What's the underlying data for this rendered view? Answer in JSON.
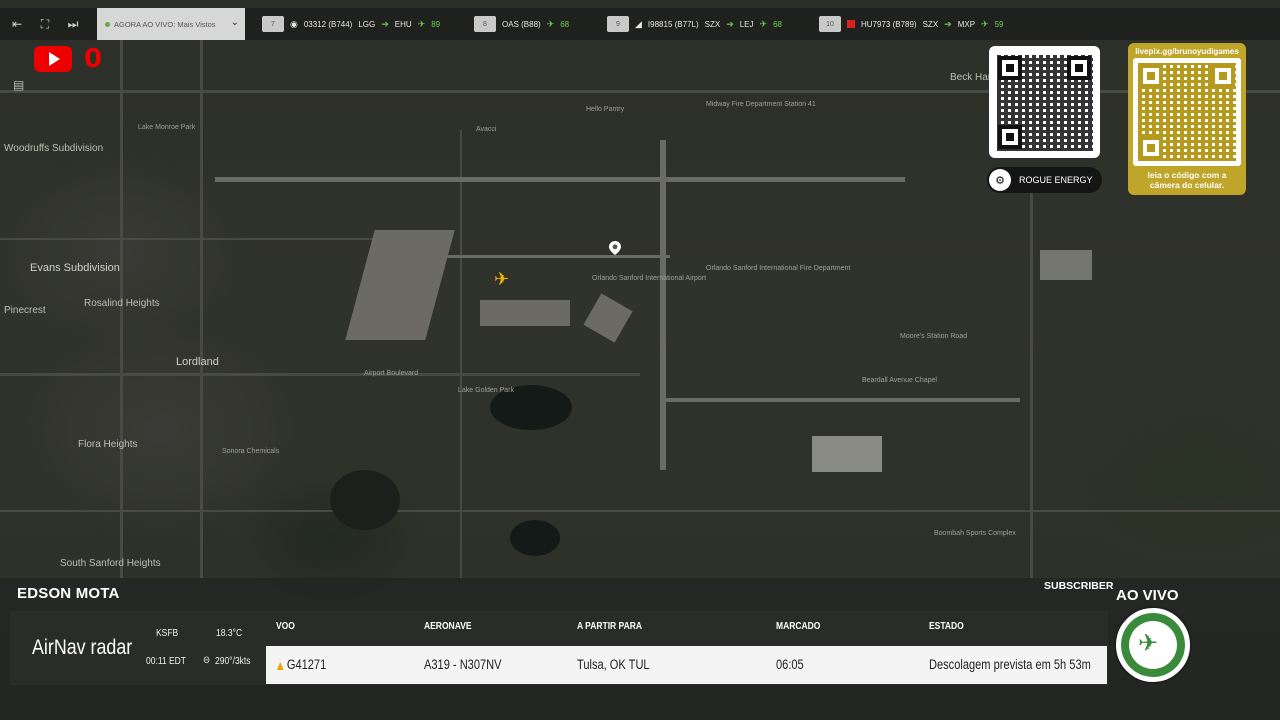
{
  "topbar": {
    "live_label": "AGORA AO VIVO: Mais Vistos",
    "flights": [
      {
        "num": "7",
        "callsign": "03312 (B744)",
        "origin": "LGG",
        "dest": "EHU",
        "alt": "89"
      },
      {
        "num": "8",
        "callsign": "OAS (B88)",
        "origin": "",
        "dest": "",
        "alt": "68"
      },
      {
        "num": "9",
        "callsign": "I98815 (B77L)",
        "origin": "SZX",
        "dest": "LEJ",
        "alt": "68"
      },
      {
        "num": "10",
        "callsign": "HU7973 (B789)",
        "origin": "SZX",
        "dest": "MXP",
        "alt": "59"
      }
    ]
  },
  "youtube": {
    "count": "0"
  },
  "sponsor": {
    "name": "ROGUE ENERGY"
  },
  "qr_gold": {
    "url": "livepix.gg/brunoyudigames",
    "caption_line1": "leia o código com a",
    "caption_line2": "câmera do celular."
  },
  "map": {
    "labels": [
      "Woodruffs Subdivision",
      "Evans Subdivision",
      "Pinecrest",
      "Rosalind Heights",
      "Lordland",
      "Flora Heights",
      "South Sanford Heights",
      "Beck Hammock",
      "Midway Fire Department Station 41",
      "Orlando Sanford International Airport",
      "Orlando Sanford International Fire Department",
      "Lake Golden Park",
      "Beardall Avenue Chapel",
      "Moore's Station Road",
      "Boombah Sports Complex",
      "Sonora Chemicals",
      "Hello Pantry",
      "Avacci",
      "Lake Monroe Park",
      "Airport Boulevard"
    ]
  },
  "bottom": {
    "streamer": "EDSON MOTA",
    "subscriber_label": "SUBSCRIBER",
    "ao_vivo": "AO VIVO",
    "brand": "AirNav radar",
    "airport": "KSFB",
    "temperature": "18.3°C",
    "time": "00:11 EDT",
    "wind": "290°/3kts",
    "headers": {
      "flight": "VOO",
      "aircraft": "AERONAVE",
      "route": "A PARTIR PARA",
      "scheduled": "MARCADO",
      "status": "ESTADO"
    },
    "row": {
      "flight": "G41271",
      "aircraft": "A319 - N307NV",
      "route": "Tulsa, OK TUL",
      "scheduled": "06:05",
      "status": "Descolagem prevista em 5h 53m"
    }
  },
  "colors": {
    "accent_green": "#6ad04b",
    "youtube_red": "#e00000",
    "livepix_gold": "#bfa52a",
    "plane_yellow": "#f2b400"
  }
}
